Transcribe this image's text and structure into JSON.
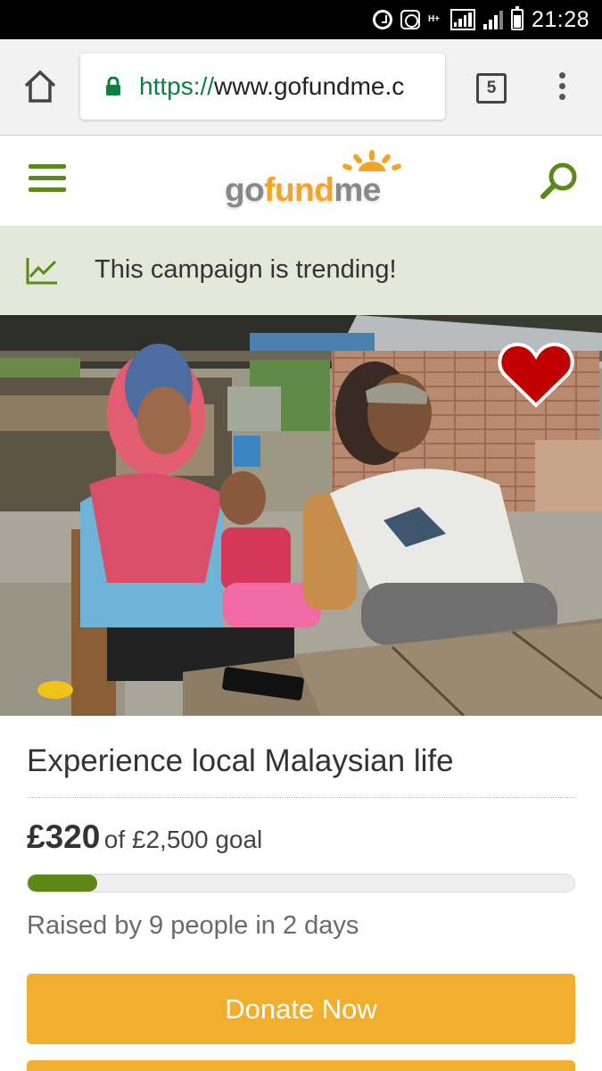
{
  "status_bar": {
    "time": "21:28",
    "network": "H+"
  },
  "browser": {
    "url_scheme": "https://",
    "url_host": "www.gofundme.c",
    "tab_count": "5"
  },
  "site_header": {
    "logo": {
      "part_go": "go",
      "part_fund": "fund",
      "part_me": "me"
    }
  },
  "trending_banner": {
    "text": "This campaign is trending!"
  },
  "campaign": {
    "title": "Experience local Malaysian life",
    "raised_amount": "£320",
    "goal_text": "of £2,500 goal",
    "raised_fraction": 0.128,
    "raised_by_text": "Raised by 9 people in 2 days"
  },
  "actions": {
    "donate_label": "Donate Now"
  },
  "colors": {
    "brand_green": "#5f8716",
    "donate_orange": "#f2ae2f",
    "heart_red": "#c10000",
    "trending_bg": "#e4e8d8"
  },
  "icons": {
    "home": "home-icon",
    "lock": "lock-icon",
    "tabs": "tabs-icon",
    "overflow_menu": "more-vert-icon",
    "hamburger": "hamburger-menu-icon",
    "search": "search-icon",
    "trending": "trending-up-icon",
    "favorite": "heart-icon"
  }
}
